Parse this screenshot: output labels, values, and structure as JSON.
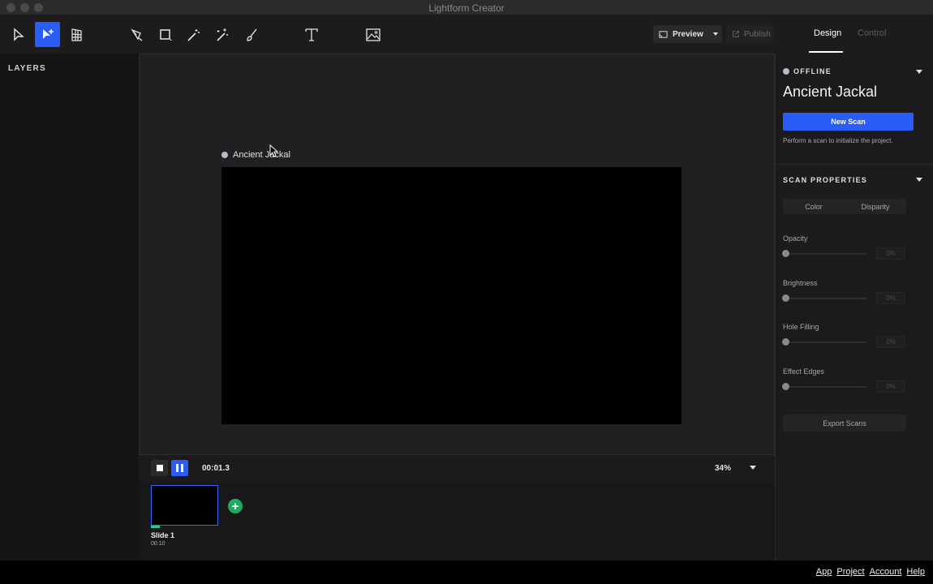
{
  "window": {
    "title": "Lightform Creator"
  },
  "toolbar": {
    "tools": [
      {
        "icon": "select-arrow-icon"
      },
      {
        "icon": "direct-select-icon",
        "active": true
      },
      {
        "icon": "warp-grid-icon"
      },
      {
        "icon": "pen-icon"
      },
      {
        "icon": "rectangle-icon"
      },
      {
        "icon": "magic-wand-icon"
      },
      {
        "icon": "magic-wand-plus-icon"
      },
      {
        "icon": "brush-icon"
      },
      {
        "icon": "text-icon"
      },
      {
        "icon": "image-icon"
      }
    ],
    "preview_label": "Preview",
    "publish_label": "Publish"
  },
  "tabs": {
    "design": "Design",
    "control": "Control"
  },
  "layers": {
    "title": "LAYERS"
  },
  "stage": {
    "label": "Ancient Jackal"
  },
  "transport": {
    "time": "00:01.3",
    "zoom": "34%"
  },
  "slides": [
    {
      "title": "Slide 1",
      "duration": "00:10",
      "progress": 0.13
    }
  ],
  "panel": {
    "status": "OFFLINE",
    "project_name": "Ancient Jackal",
    "new_scan_label": "New Scan",
    "scan_hint": "Perform a scan to initialize the project.",
    "scan_properties_title": "SCAN PROPERTIES",
    "segments": [
      "Color",
      "Disparity"
    ],
    "properties": [
      {
        "label": "Opacity",
        "value": "0%"
      },
      {
        "label": "Brightness",
        "value": "0%"
      },
      {
        "label": "Hole Filling",
        "value": "0%"
      },
      {
        "label": "Effect Edges",
        "value": "0%"
      }
    ],
    "export_label": "Export Scans"
  },
  "footer": {
    "links": [
      "App",
      "Project",
      "Account",
      "Help"
    ]
  },
  "colors": {
    "accent": "#2c5cf6",
    "add": "#1faa60",
    "progress": "#2fc5a0"
  }
}
